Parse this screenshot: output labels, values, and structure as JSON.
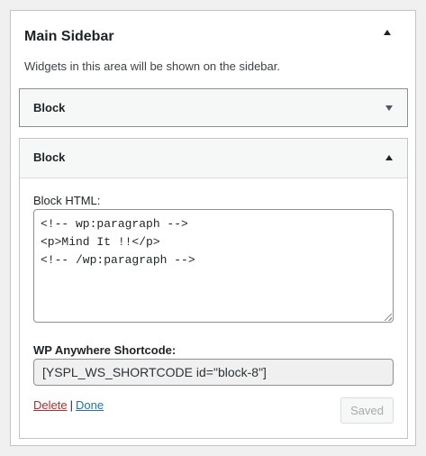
{
  "sidebar": {
    "title": "Main Sidebar",
    "description": "Widgets in this area will be shown on the sidebar."
  },
  "widgets": [
    {
      "title": "Block",
      "expanded": false
    },
    {
      "title": "Block",
      "expanded": true,
      "html_label": "Block HTML:",
      "html_value": "<!-- wp:paragraph -->\n<p>Mind It !!</p>\n<!-- /wp:paragraph -->",
      "shortcode_label": "WP Anywhere Shortcode:",
      "shortcode_value": "[YSPL_WS_SHORTCODE id=\"block-8\"]",
      "delete_label": "Delete",
      "separator": "|",
      "done_label": "Done",
      "save_label": "Saved"
    }
  ],
  "icons": {
    "collapse": "chevron-up-icon",
    "expand": "chevron-down-icon"
  },
  "colors": {
    "delete": "#b32d2e",
    "link": "#2271b1",
    "border": "#c3c4c7"
  }
}
